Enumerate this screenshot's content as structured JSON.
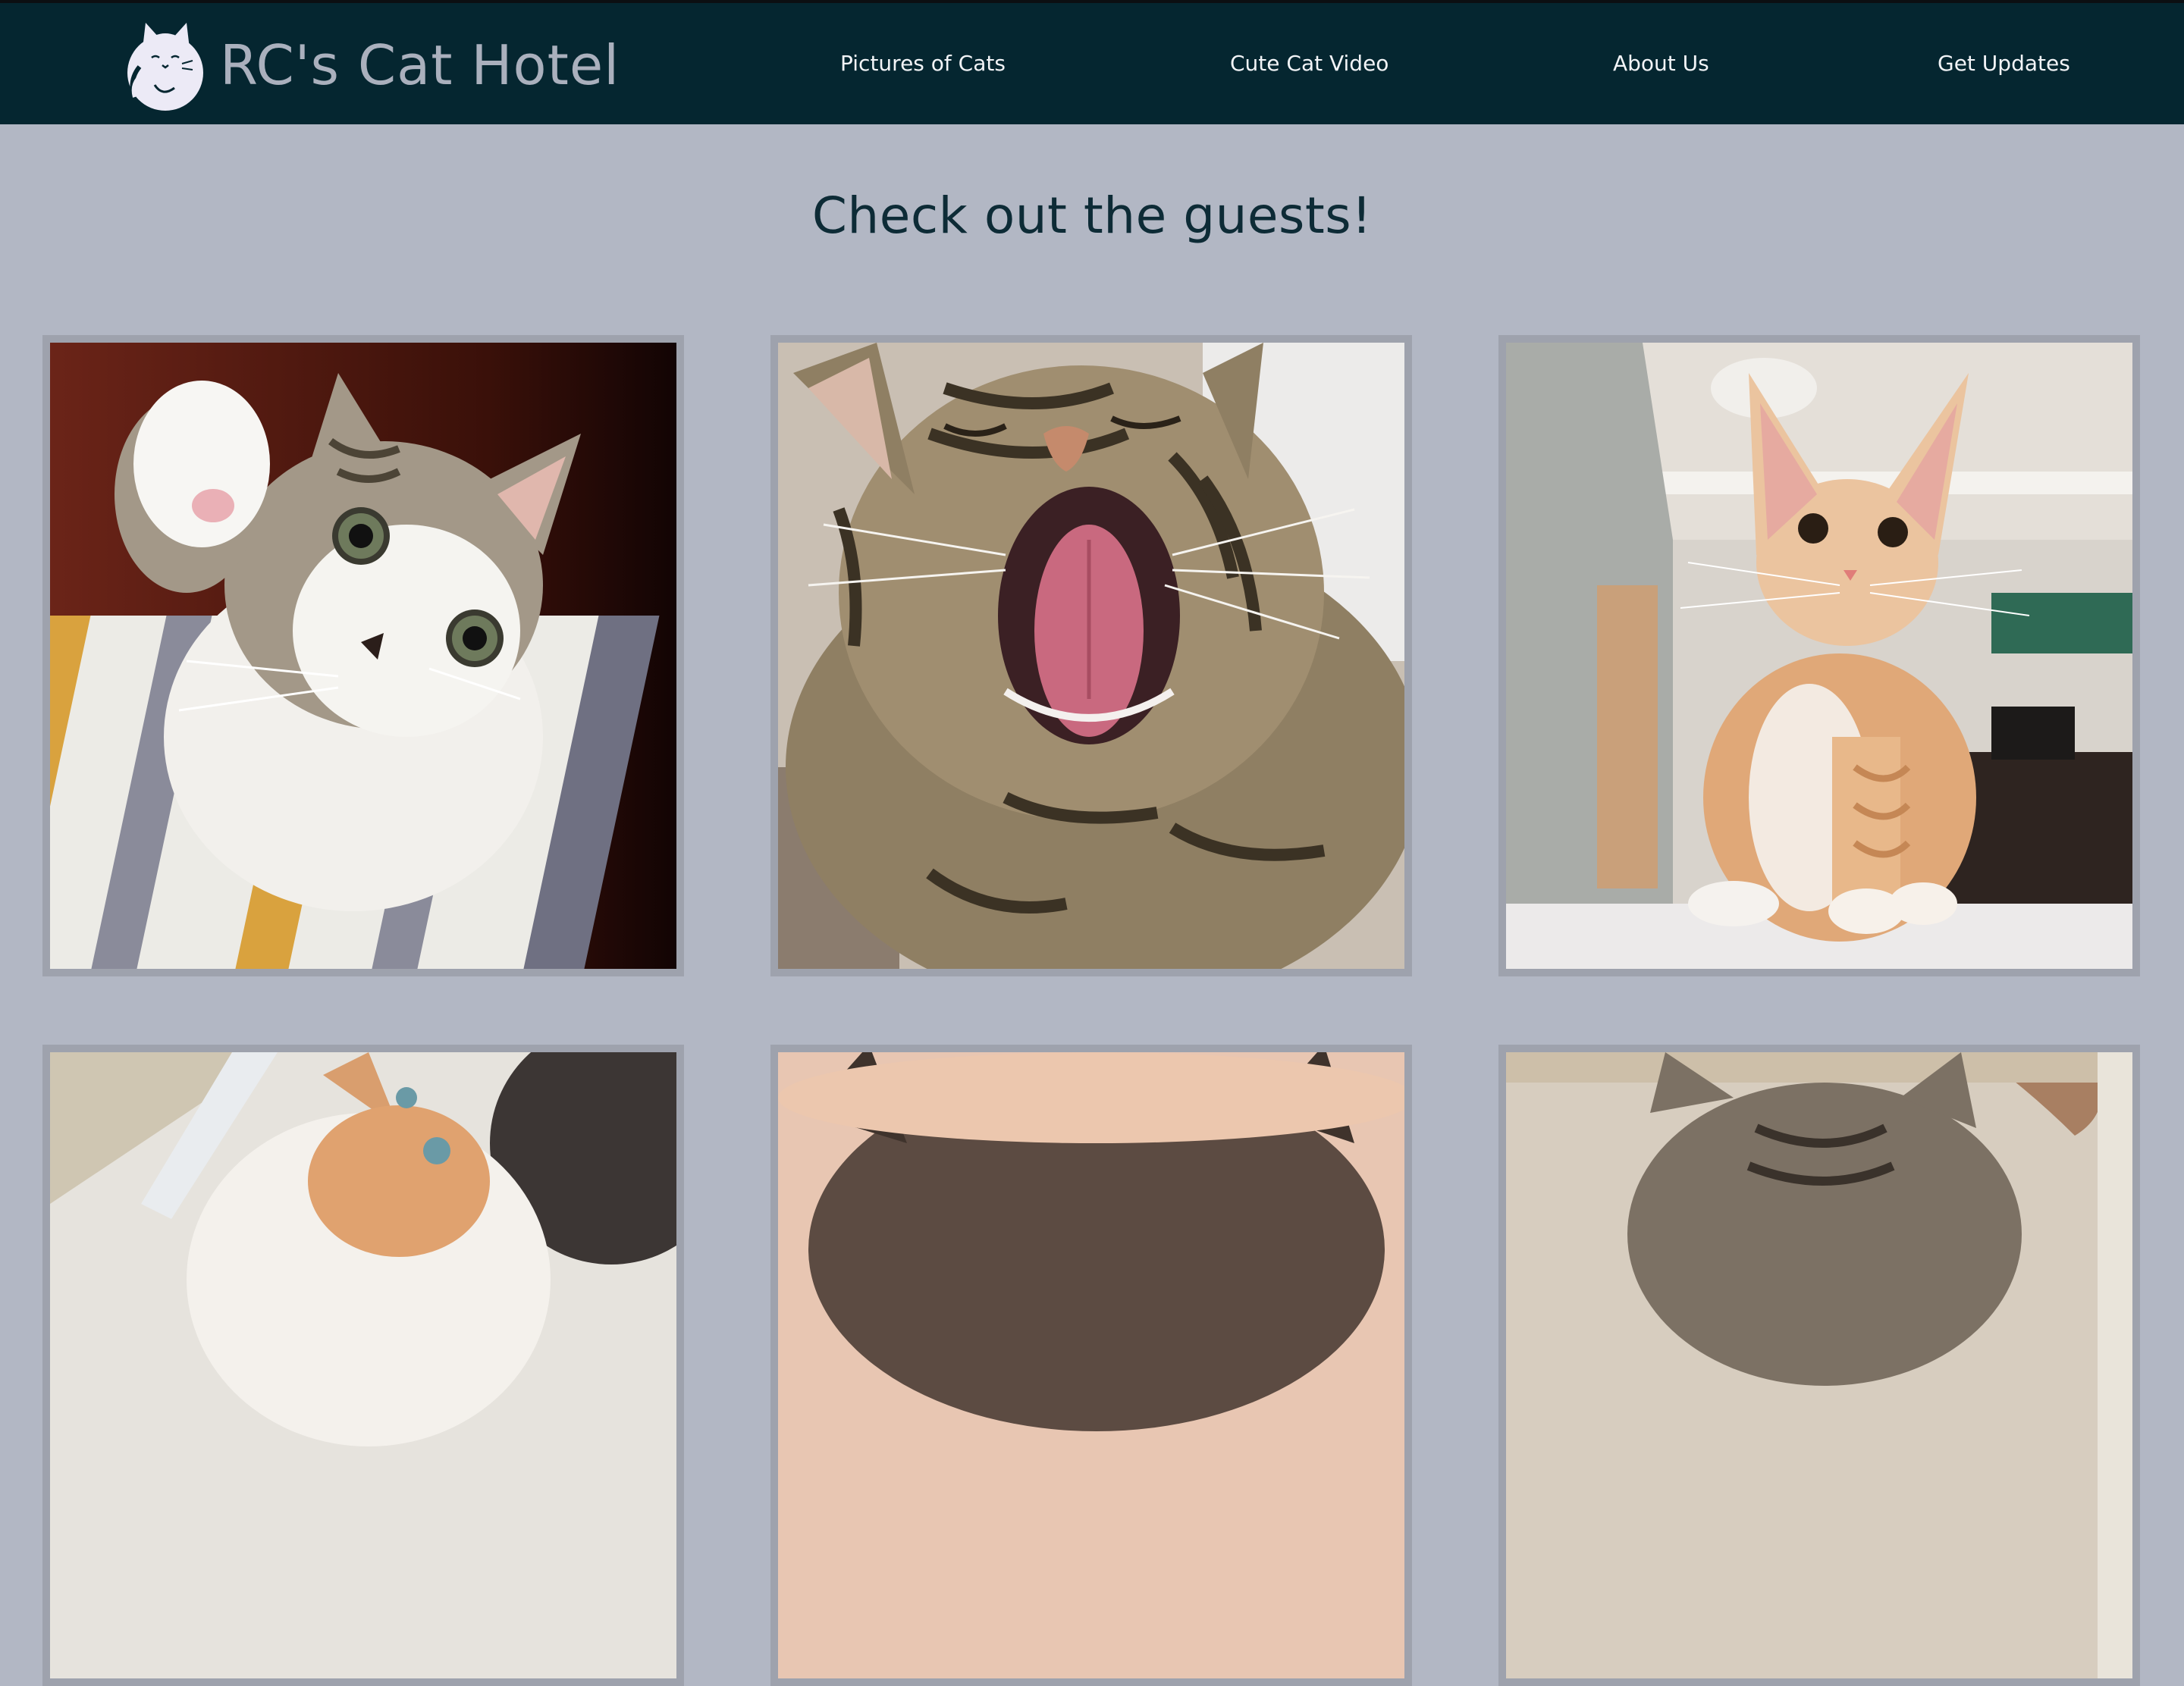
{
  "brand": {
    "name": "RC's Cat Hotel",
    "logo_icon": "cat-face-icon"
  },
  "nav": {
    "items": [
      {
        "label": "Pictures of Cats"
      },
      {
        "label": "Cute Cat Video"
      },
      {
        "label": "About Us"
      },
      {
        "label": "Get Updates"
      }
    ]
  },
  "main": {
    "heading": "Check out the guests!"
  },
  "gallery": {
    "photos": [
      {
        "alt": "Tabby and white kitten raising its paw"
      },
      {
        "alt": "Tabby cat yawning with mouth wide open"
      },
      {
        "alt": "Orange kitten sitting on a cat tree"
      },
      {
        "alt": "Ginger and white kitten"
      },
      {
        "alt": "Long-haired cat"
      },
      {
        "alt": "Grey tabby kitten"
      }
    ]
  },
  "colors": {
    "header_bg": "#052630",
    "page_bg": "#b2b7c4",
    "heading": "#0d2b36",
    "card_border": "#9ea2ad"
  }
}
